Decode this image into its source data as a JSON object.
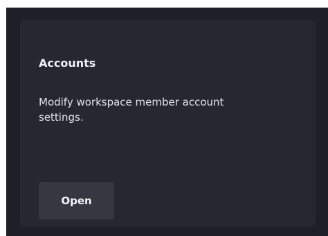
{
  "card": {
    "title": "Accounts",
    "description": "Modify workspace member account settings.",
    "open_label": "Open"
  },
  "colors": {
    "outer_background": "#1d2027",
    "card_background": "#262830",
    "button_background": "#353841",
    "text_primary": "#f0f1f4"
  }
}
